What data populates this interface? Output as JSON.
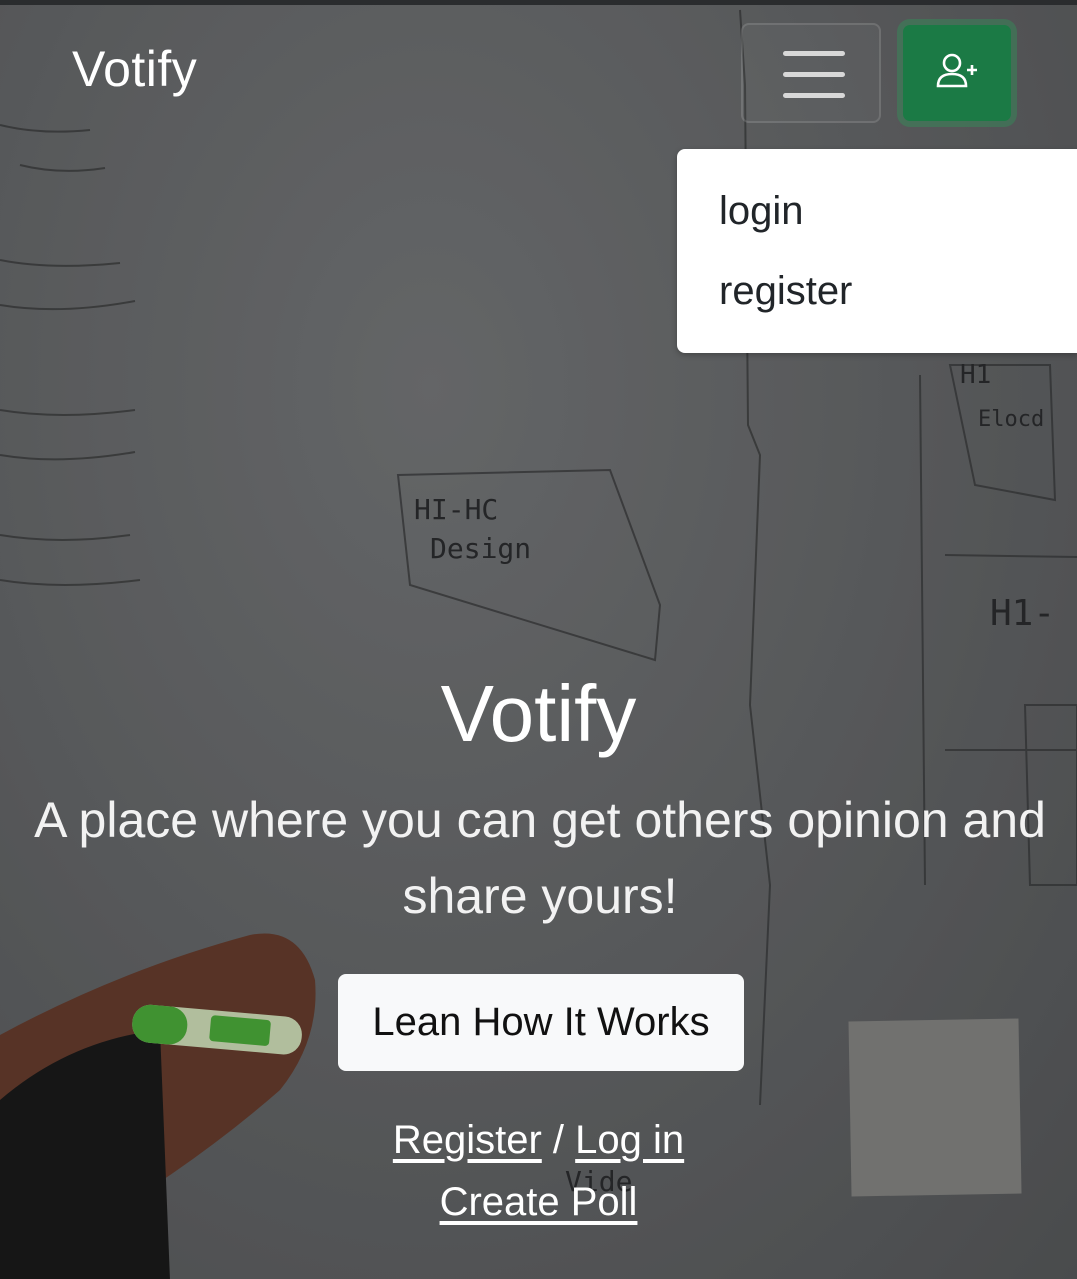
{
  "navbar": {
    "brand": "Votify",
    "toggler_icon": "hamburger-menu-icon",
    "user_button_icon": "person-plus-icon"
  },
  "dropdown": {
    "items": [
      "login",
      "register"
    ]
  },
  "hero": {
    "title": "Votify",
    "subtitle": "A place where you can get others opinion and share yours!",
    "cta_label": "Lean How It Works",
    "register_link": "Register",
    "separator": "/",
    "login_link": "Log in",
    "create_poll_link": "Create Poll",
    "background_image": "whiteboard-hand-marker-photo",
    "whiteboard_texts": [
      "HI-HC",
      "Design",
      "H1",
      "Elocd",
      "H1-",
      "Vide"
    ]
  },
  "colors": {
    "accent": "#1b7a45",
    "overlay": "#6c6e70",
    "text": "#ffffff"
  }
}
